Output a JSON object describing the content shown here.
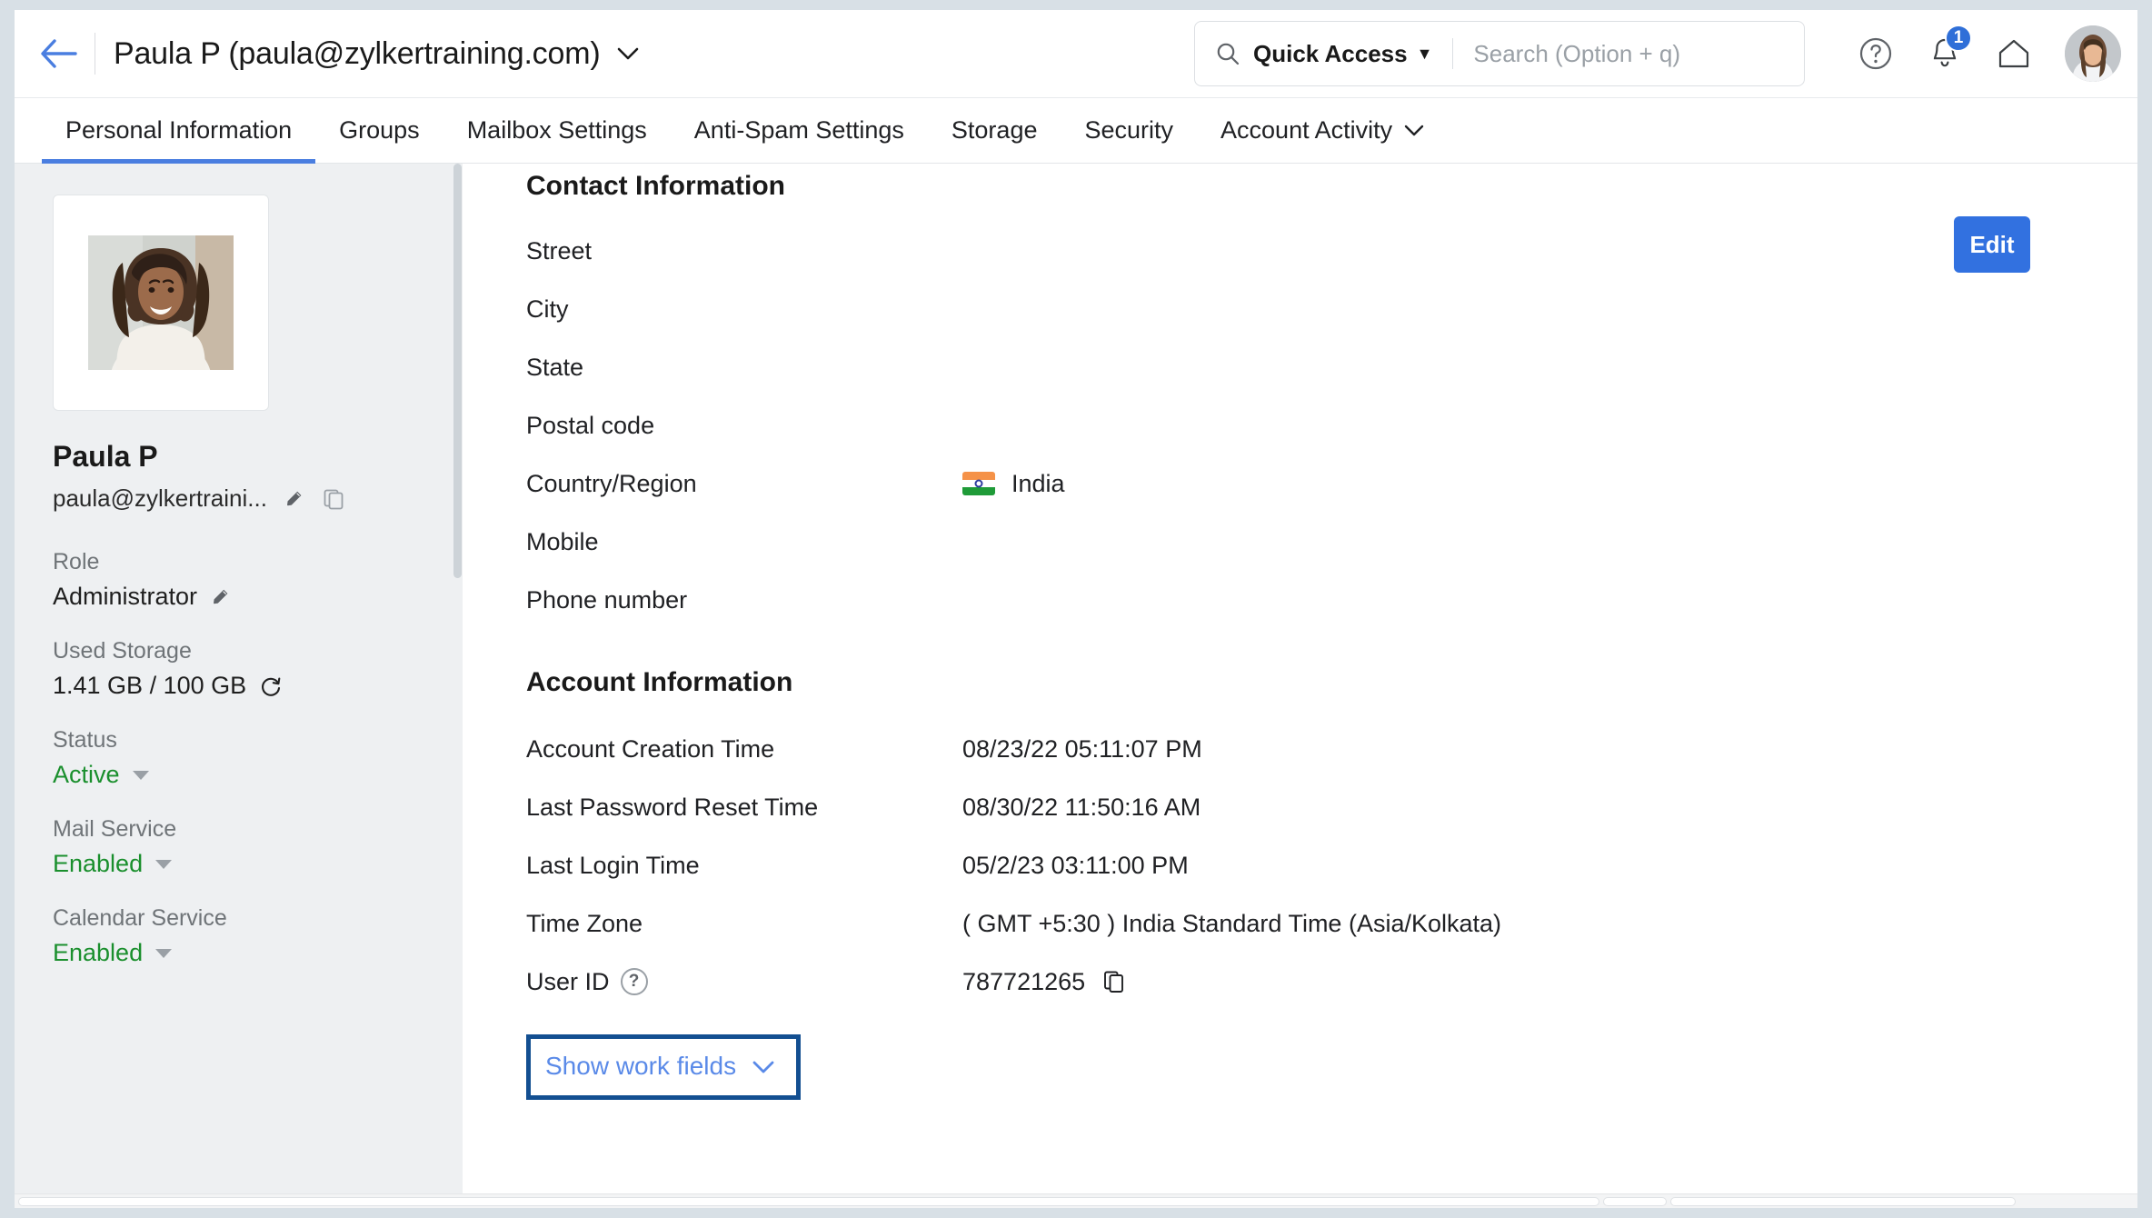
{
  "header": {
    "back_icon": "back-arrow-icon",
    "title": "Paula P (paula@zylkertraining.com)",
    "title_caret": "chevron-down-icon",
    "search": {
      "icon": "search-icon",
      "quick_access_label": "Quick Access",
      "quick_access_caret": "▼",
      "placeholder": "Search (Option + q)",
      "value": ""
    },
    "help_icon": "help-circle-icon",
    "bell_icon": "notification-bell-icon",
    "notification_count": "1",
    "home_icon": "home-icon",
    "avatar": "user-avatar"
  },
  "tabs": [
    {
      "label": "Personal Information",
      "active": true,
      "caret": ""
    },
    {
      "label": "Groups",
      "active": false,
      "caret": ""
    },
    {
      "label": "Mailbox Settings",
      "active": false,
      "caret": ""
    },
    {
      "label": "Anti-Spam Settings",
      "active": false,
      "caret": ""
    },
    {
      "label": "Storage",
      "active": false,
      "caret": ""
    },
    {
      "label": "Security",
      "active": false,
      "caret": ""
    },
    {
      "label": "Account Activity",
      "active": false,
      "caret": "chevron-down-icon"
    }
  ],
  "sidebar": {
    "photo": "profile-photo",
    "name": "Paula P",
    "email": "paula@zylkertraini...",
    "email_edit_icon": "pencil-icon",
    "email_copy_icon": "copy-icon",
    "fields": [
      {
        "label": "Role",
        "value": "Administrator",
        "green": false,
        "edit": true,
        "caret": false,
        "refresh": false
      },
      {
        "label": "Used Storage",
        "value": "1.41 GB / 100 GB",
        "green": false,
        "edit": false,
        "caret": false,
        "refresh": true
      },
      {
        "label": "Status",
        "value": "Active",
        "green": true,
        "edit": false,
        "caret": true,
        "refresh": false
      },
      {
        "label": "Mail Service",
        "value": "Enabled",
        "green": true,
        "edit": false,
        "caret": true,
        "refresh": false
      },
      {
        "label": "Calendar Service",
        "value": "Enabled",
        "green": true,
        "edit": false,
        "caret": true,
        "refresh": false
      }
    ]
  },
  "main": {
    "edit_button": "Edit",
    "contact_section": {
      "title": "Contact Information",
      "rows": [
        {
          "label": "Street",
          "value": "",
          "flag": false,
          "help": false,
          "copy": false
        },
        {
          "label": "City",
          "value": "",
          "flag": false,
          "help": false,
          "copy": false
        },
        {
          "label": "State",
          "value": "",
          "flag": false,
          "help": false,
          "copy": false
        },
        {
          "label": "Postal code",
          "value": "",
          "flag": false,
          "help": false,
          "copy": false
        },
        {
          "label": "Country/Region",
          "value": "India",
          "flag": true,
          "help": false,
          "copy": false
        },
        {
          "label": "Mobile",
          "value": "",
          "flag": false,
          "help": false,
          "copy": false
        },
        {
          "label": "Phone number",
          "value": "",
          "flag": false,
          "help": false,
          "copy": false
        }
      ]
    },
    "account_section": {
      "title": "Account Information",
      "rows": [
        {
          "label": "Account Creation Time",
          "value": "08/23/22 05:11:07 PM",
          "flag": false,
          "help": false,
          "copy": false
        },
        {
          "label": "Last Password Reset Time",
          "value": "08/30/22 11:50:16 AM",
          "flag": false,
          "help": false,
          "copy": false
        },
        {
          "label": "Last Login Time",
          "value": "05/2/23 03:11:00 PM",
          "flag": false,
          "help": false,
          "copy": false
        },
        {
          "label": "Time Zone",
          "value": "( GMT +5:30 ) India Standard Time (Asia/Kolkata)",
          "flag": false,
          "help": false,
          "copy": false
        },
        {
          "label": "User ID",
          "value": "787721265",
          "flag": false,
          "help": true,
          "copy": true
        }
      ]
    },
    "show_work_fields": {
      "label": "Show work fields",
      "caret": "chevron-down-icon",
      "highlight_color": "#134f91"
    }
  },
  "colors": {
    "accent_blue": "#3271e0",
    "link_blue": "#5a8ae8",
    "active_green": "#1a8f2d",
    "tab_underline": "#4a7ee0",
    "window_chrome": "#d8e0e6"
  }
}
